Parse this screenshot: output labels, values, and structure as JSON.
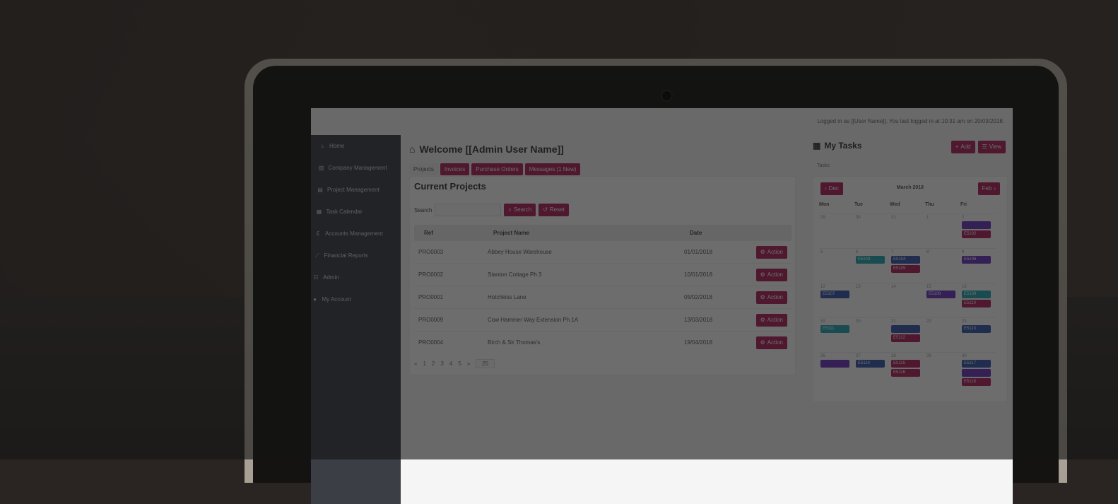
{
  "topbar": {
    "login_text": "Logged in as [[User Name]]. You last logged in at 10:31 am on 20/03/2018."
  },
  "sidebar": {
    "items": [
      {
        "label": "Home",
        "icon": "home-icon"
      },
      {
        "label": "Company Management",
        "icon": "building-icon"
      },
      {
        "label": "Project Management",
        "icon": "folder-icon"
      },
      {
        "label": "Task Calendar",
        "icon": "calendar-icon"
      },
      {
        "label": "Accounts Management",
        "icon": "pound-icon"
      },
      {
        "label": "Financial Reports",
        "icon": "chart-icon"
      },
      {
        "label": "Admin",
        "icon": "users-icon"
      },
      {
        "label": "My Account",
        "icon": "user-icon"
      }
    ]
  },
  "main": {
    "welcome": "Welcome [[Admin User Name]]",
    "tabs": [
      {
        "label": "Projects"
      },
      {
        "label": "Invoices"
      },
      {
        "label": "Purchase Orders"
      },
      {
        "label": "Messages (1 New)"
      }
    ],
    "panel_title": "Current Projects",
    "search_label": "Search",
    "search_button": "Search",
    "reset_button": "Reset",
    "table": {
      "headers": [
        "Ref",
        "Project Name",
        "Date",
        ""
      ],
      "rows": [
        {
          "ref": "PRO0003",
          "name": "Abbey House Warehouse",
          "date": "01/01/2018",
          "action": "Action"
        },
        {
          "ref": "PRO0002",
          "name": "Stanton Cottage Ph 3",
          "date": "10/01/2018",
          "action": "Action"
        },
        {
          "ref": "PRO0001",
          "name": "Hotchkiss Lane",
          "date": "05/02/2018",
          "action": "Action"
        },
        {
          "ref": "PRO0009",
          "name": "Cow Hammer Way Extension Ph 1A",
          "date": "13/03/2018",
          "action": "Action"
        },
        {
          "ref": "PRO0004",
          "name": "Birch & Sir Thomas's",
          "date": "19/04/2018",
          "action": "Action"
        }
      ]
    },
    "pager": {
      "pages": [
        "«",
        "1",
        "2",
        "3",
        "4",
        "5",
        "»"
      ],
      "page_size": "25"
    }
  },
  "tasks": {
    "title": "My Tasks",
    "add_button": "Add",
    "view_button": "View",
    "filter_label": "Tasks",
    "calendar": {
      "prev": "Dec",
      "next": "Feb",
      "month": "March 2018",
      "days": [
        "Mon",
        "Tue",
        "Wed",
        "Thu",
        "Fri"
      ],
      "weeks": [
        [
          {
            "n": "29",
            "ev": []
          },
          {
            "n": "30",
            "ev": []
          },
          {
            "n": "31",
            "ev": []
          },
          {
            "n": "1",
            "ev": []
          },
          {
            "n": "2",
            "ev": [
              {
                "c": "v",
                "t": ""
              },
              {
                "c": "p",
                "t": "E5102"
              }
            ]
          }
        ],
        [
          {
            "n": "5",
            "ev": []
          },
          {
            "n": "6",
            "ev": [
              {
                "c": "t",
                "t": "E5103"
              }
            ]
          },
          {
            "n": "7",
            "ev": [
              {
                "c": "b",
                "t": "E5104"
              },
              {
                "c": "p",
                "t": "E5105"
              }
            ]
          },
          {
            "n": "8",
            "ev": []
          },
          {
            "n": "9",
            "ev": [
              {
                "c": "v",
                "t": "E5106"
              }
            ]
          }
        ],
        [
          {
            "n": "12",
            "ev": [
              {
                "c": "b",
                "t": "E5107"
              }
            ]
          },
          {
            "n": "13",
            "ev": []
          },
          {
            "n": "14",
            "ev": []
          },
          {
            "n": "15",
            "ev": [
              {
                "c": "v",
                "t": "E5108"
              }
            ]
          },
          {
            "n": "16",
            "ev": [
              {
                "c": "t",
                "t": "E5109"
              },
              {
                "c": "p",
                "t": "E5110"
              }
            ]
          }
        ],
        [
          {
            "n": "19",
            "ev": [
              {
                "c": "t",
                "t": "E5111"
              }
            ]
          },
          {
            "n": "20",
            "ev": []
          },
          {
            "n": "21",
            "ev": [
              {
                "c": "b",
                "t": ""
              },
              {
                "c": "p",
                "t": "E5112"
              }
            ]
          },
          {
            "n": "22",
            "ev": []
          },
          {
            "n": "23",
            "ev": [
              {
                "c": "b",
                "t": "E5113"
              }
            ]
          }
        ],
        [
          {
            "n": "26",
            "ev": [
              {
                "c": "v",
                "t": ""
              }
            ]
          },
          {
            "n": "27",
            "ev": [
              {
                "c": "b",
                "t": "E5114"
              }
            ]
          },
          {
            "n": "28",
            "ev": [
              {
                "c": "p",
                "t": "E5115"
              },
              {
                "c": "p",
                "t": "E5116"
              }
            ]
          },
          {
            "n": "29",
            "ev": []
          },
          {
            "n": "30",
            "ev": [
              {
                "c": "b",
                "t": "E5117"
              },
              {
                "c": "v",
                "t": ""
              },
              {
                "c": "p",
                "t": "E5118"
              }
            ]
          }
        ]
      ]
    }
  },
  "colors": {
    "accent": "#b0205a",
    "sidebar": "#3b3e44",
    "event_blue": "#3558b0",
    "event_teal": "#24a9b6",
    "event_violet": "#6a35c0"
  }
}
